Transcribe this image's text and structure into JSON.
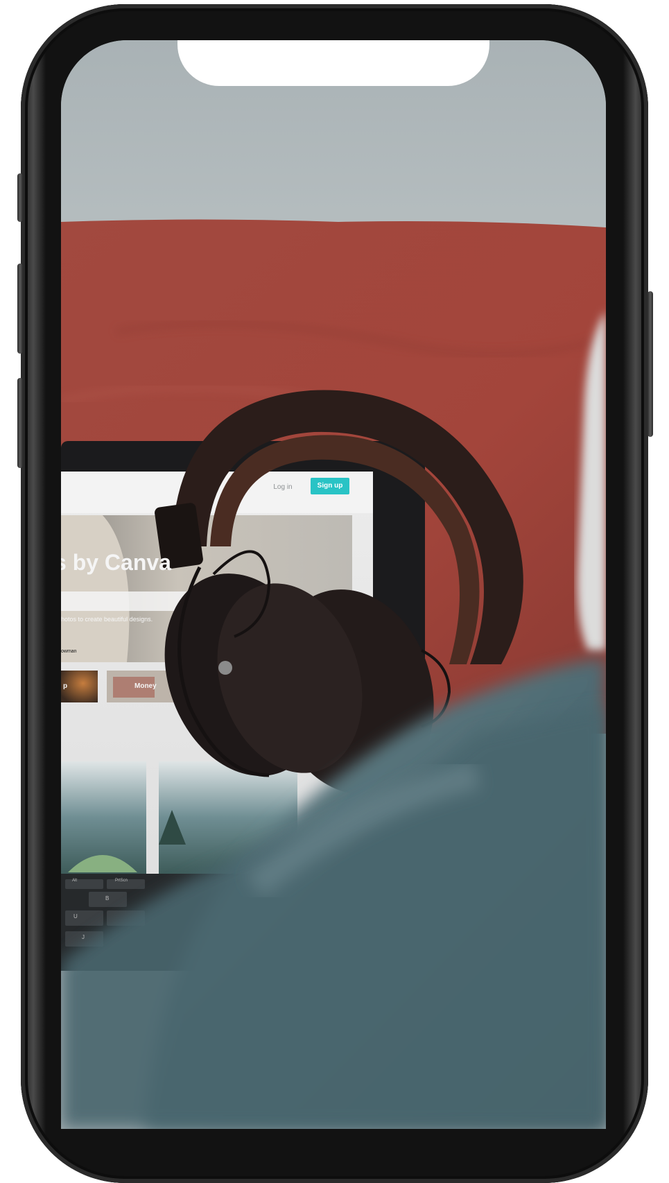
{
  "laptop_screen": {
    "login_label": "Log in",
    "signup_label": "Sign up",
    "hero_title": "s by Canva",
    "hero_subtitle": "hotos to create beautiful designs.",
    "credit": "owman",
    "category_left": "p",
    "category_money": "Money"
  },
  "keyboard": {
    "key_1": "Alt",
    "key_2": "PrtScn",
    "key_3": "B",
    "key_4": "U",
    "key_5": "J"
  },
  "colors": {
    "accent": "#29c3c5",
    "blanket": "#a4483e",
    "sweater": "#4e6a72",
    "wall": "#b0b8ba"
  }
}
